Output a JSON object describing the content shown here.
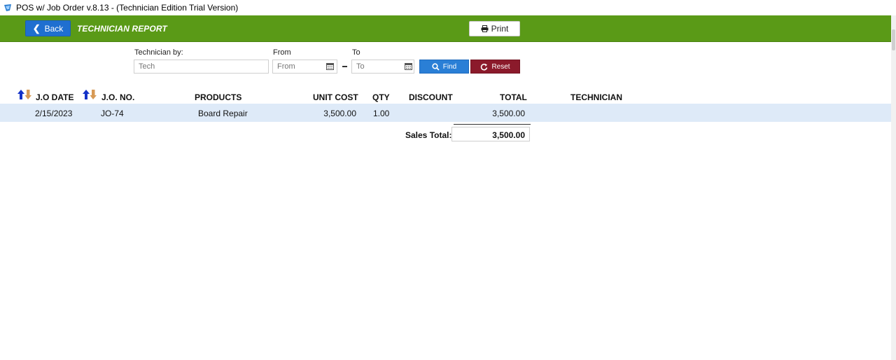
{
  "window": {
    "title": "POS w/ Job Order v.8.13 - (Technician Edition Trial Version)"
  },
  "toolbar": {
    "back_label": "Back",
    "page_title": "TECHNICIAN REPORT",
    "print_label": "Print"
  },
  "filters": {
    "technician_label": "Technician by:",
    "technician_placeholder": "Tech",
    "from_label": "From",
    "from_placeholder": "From",
    "to_label": "To",
    "to_placeholder": "To",
    "find_label": "Find",
    "reset_label": "Reset"
  },
  "table": {
    "headers": [
      "J.O DATE",
      "J.O. NO.",
      "PRODUCTS",
      "UNIT COST",
      "QTY",
      "DISCOUNT",
      "TOTAL",
      "TECHNICIAN"
    ],
    "rows": [
      {
        "date": "2/15/2023",
        "jo_no": "JO-74",
        "product": "Board Repair",
        "unit_cost": "3,500.00",
        "qty": "1.00",
        "discount": "",
        "total": "3,500.00",
        "technician": ""
      }
    ]
  },
  "summary": {
    "sales_total_label": "Sales Total:",
    "sales_total_value": "3,500.00"
  },
  "colors": {
    "toolbar": "#5a9a17",
    "back_button": "#1f6fd0",
    "find_button": "#2a7fd6",
    "reset_button": "#8b1a2b",
    "row_highlight": "#deeaf8"
  },
  "icons": [
    "app-icon",
    "chevron-left-icon",
    "printer-icon",
    "calendar-icon",
    "search-icon",
    "reset-icon",
    "sort-icon"
  ]
}
